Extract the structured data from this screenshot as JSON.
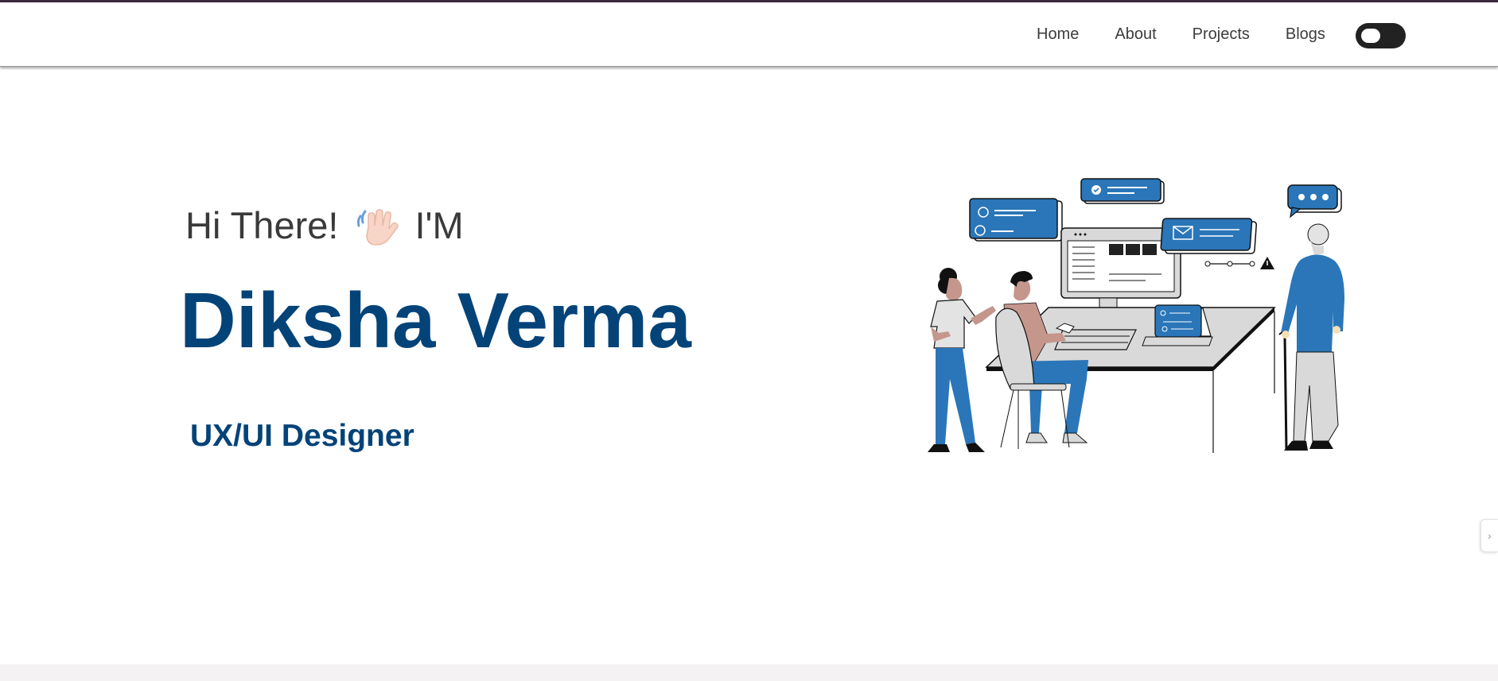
{
  "nav": {
    "items": [
      {
        "label": "Home"
      },
      {
        "label": "About"
      },
      {
        "label": "Projects"
      },
      {
        "label": "Blogs"
      }
    ],
    "theme_toggle": {
      "icon": "theme-toggle-switch",
      "state": "off"
    }
  },
  "hero": {
    "greeting": "Hi There!",
    "greeting_suffix": "I'M",
    "wave_icon": "waving-hand-icon",
    "name": "Diksha Verma",
    "role": "UX/UI Designer",
    "illustration": "team-working-at-computer-illustration"
  },
  "side_tab": {
    "icon": "chevron-right-icon",
    "glyph": "›"
  },
  "colors": {
    "primary": "#034378",
    "text": "#3a3a3a",
    "illustration_blue": "#2a76b8",
    "skin": "#c4968c",
    "toggle": "#222222",
    "top_accent": "#3a2a3f"
  }
}
